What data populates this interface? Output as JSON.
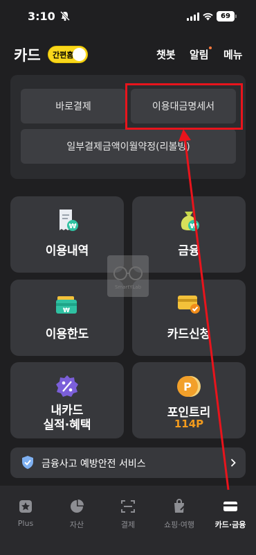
{
  "status_bar": {
    "time": "3:10",
    "battery": "69"
  },
  "header": {
    "title": "카드",
    "easy_label": "간편홈",
    "links": [
      "챗봇",
      "알림",
      "메뉴"
    ]
  },
  "top_buttons": {
    "direct_pay": "바로결제",
    "statement": "이용대금명세서",
    "revolving": "일부결제금액이월약정(리볼빙)"
  },
  "tiles": [
    {
      "id": "usage",
      "label": "이용내역",
      "icon": "receipt-won-icon"
    },
    {
      "id": "finance",
      "label": "금융",
      "icon": "money-bag-won-icon"
    },
    {
      "id": "limit",
      "label": "이용한도",
      "icon": "wallet-won-icon"
    },
    {
      "id": "apply",
      "label": "카드신청",
      "icon": "card-check-icon"
    },
    {
      "id": "benefit",
      "label_line1": "내카드",
      "label_line2": "실적·혜택",
      "icon": "percent-badge-icon"
    },
    {
      "id": "points",
      "label": "포인트리",
      "points": "114P",
      "icon": "point-coin-icon"
    }
  ],
  "security": {
    "label": "금융사고 예방안전 서비스"
  },
  "bottom_nav": [
    {
      "label": "Plus",
      "icon": "star-plus-icon"
    },
    {
      "label": "자산",
      "icon": "pie-chart-icon"
    },
    {
      "label": "결제",
      "icon": "scan-pay-icon"
    },
    {
      "label": "쇼핑·여행",
      "icon": "shopping-bag-icon"
    },
    {
      "label": "카드·금융",
      "icon": "card-icon",
      "active": true
    }
  ],
  "watermark_text": "SmartYLab",
  "colors": {
    "accent_yellow": "#f9d71c",
    "points_orange": "#f39b1d",
    "annotation_red": "#e8141c",
    "background": "#1f1f21"
  }
}
